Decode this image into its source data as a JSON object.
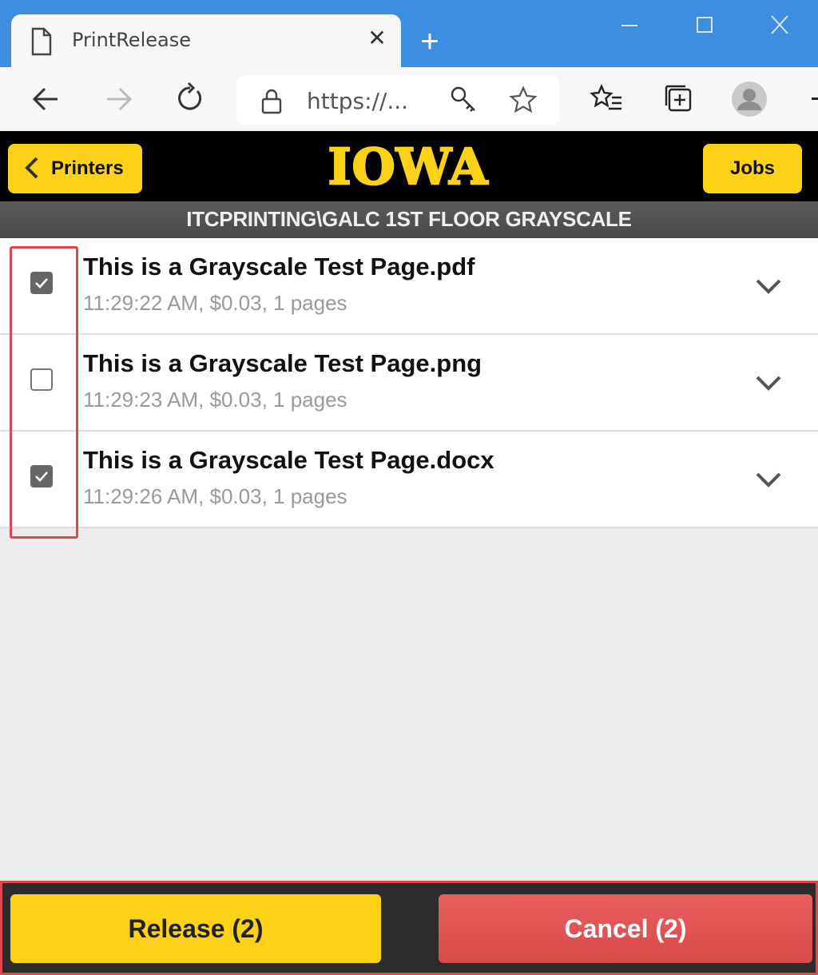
{
  "browser": {
    "tab_title": "PrintRelease",
    "address": "https://..."
  },
  "header": {
    "back_label": "Printers",
    "logo_text": "IOWA",
    "jobs_label": "Jobs",
    "printer_name": "ITCPRINTING\\GALC 1ST FLOOR GRAYSCALE"
  },
  "jobs": [
    {
      "name": "This is a Grayscale Test Page.pdf",
      "meta": "11:29:22 AM, $0.03, 1 pages",
      "selected": true
    },
    {
      "name": "This is a Grayscale Test Page.png",
      "meta": "11:29:23 AM, $0.03, 1 pages",
      "selected": false
    },
    {
      "name": "This is a Grayscale Test Page.docx",
      "meta": "11:29:26 AM, $0.03, 1 pages",
      "selected": true
    }
  ],
  "footer": {
    "release_label": "Release (2)",
    "cancel_label": "Cancel (2)"
  },
  "colors": {
    "brand_gold": "#fcd116",
    "cancel_red": "#d9494a",
    "highlight": "#e0474c"
  }
}
